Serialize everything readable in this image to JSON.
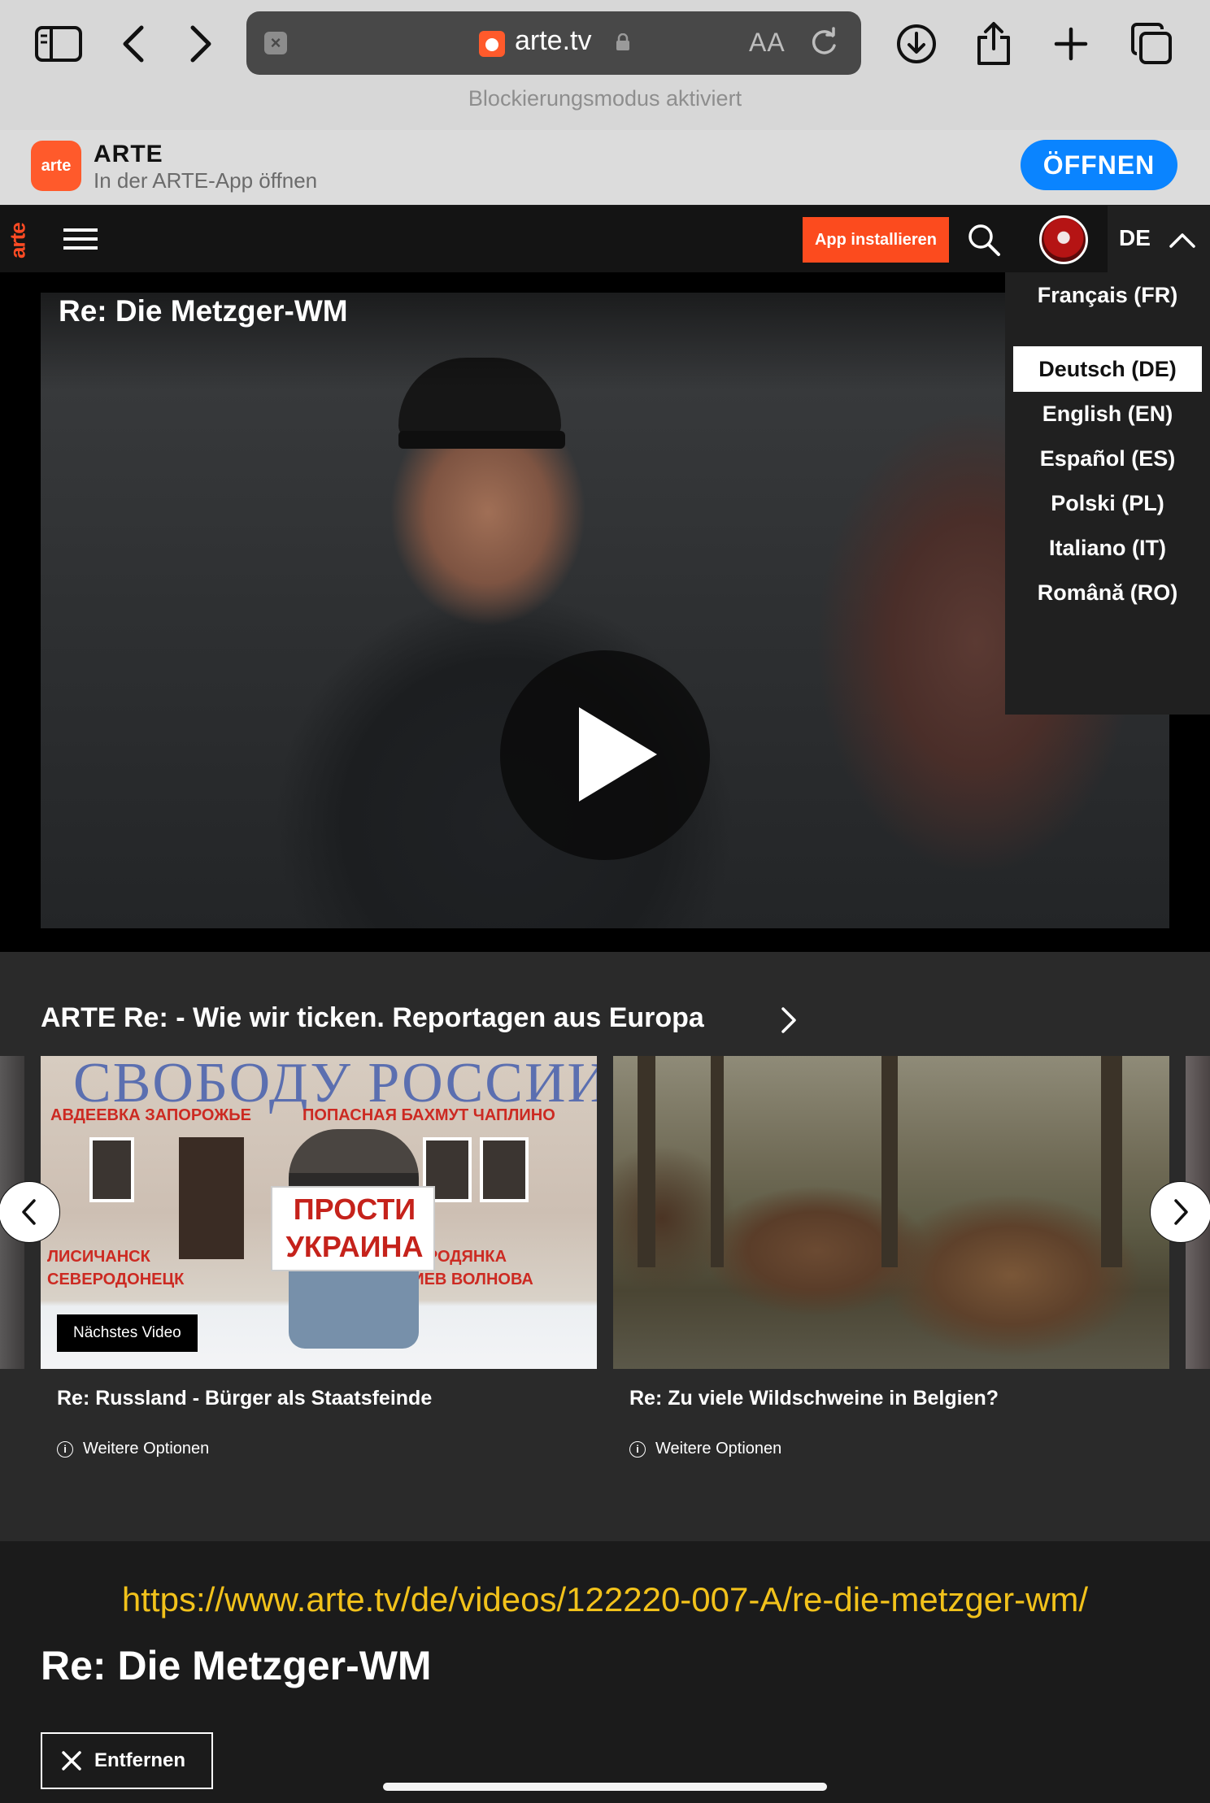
{
  "browser": {
    "domain": "arte.tv",
    "reader_label": "AA",
    "status_message": "Blockierungsmodus aktiviert",
    "toolbar_icons": [
      "sidebar-icon",
      "back-icon",
      "forward-icon",
      "download-icon",
      "share-icon",
      "new-tab-icon",
      "tabs-icon"
    ]
  },
  "app_banner": {
    "logo_text": "arte",
    "name": "ARTE",
    "subtitle": "In der ARTE-App öffnen",
    "open_label": "ÖFFNEN"
  },
  "header": {
    "logo_text": "arte",
    "install_label": "App installieren",
    "lang_code": "DE"
  },
  "language_menu": {
    "items": [
      {
        "label": "Français (FR)",
        "active": false
      },
      {
        "label": "Deutsch (DE)",
        "active": true
      },
      {
        "label": "English (EN)",
        "active": false
      },
      {
        "label": "Español (ES)",
        "active": false
      },
      {
        "label": "Polski (PL)",
        "active": false
      },
      {
        "label": "Italiano (IT)",
        "active": false
      },
      {
        "label": "Română (RO)",
        "active": false
      }
    ]
  },
  "video": {
    "title": "Re: Die Metzger-WM"
  },
  "row": {
    "title": "ARTE Re: - Wie wir ticken. Reportagen aus Europa",
    "cards": [
      {
        "badge": "Nächstes Video",
        "title": "Re: Russland - Bürger als Staatsfeinde",
        "options_label": "Weitere Optionen",
        "thumb_text": {
          "banner": "СВОБОДУ РОССИИ",
          "sign_line1": "ПРОСТИ",
          "sign_line2": "УКРАИНА"
        }
      },
      {
        "title": "Re: Zu viele Wildschweine in Belgien?",
        "options_label": "Weitere Optionen"
      }
    ]
  },
  "bottom": {
    "url": "https://www.arte.tv/de/videos/122220-007-A/re-die-metzger-wm/",
    "title": "Re: Die Metzger-WM",
    "remove_label": "Entfernen"
  },
  "colors": {
    "arte_orange": "#fc4b1e",
    "ios_blue": "#0a84ff",
    "url_yellow": "#f2c21b"
  }
}
